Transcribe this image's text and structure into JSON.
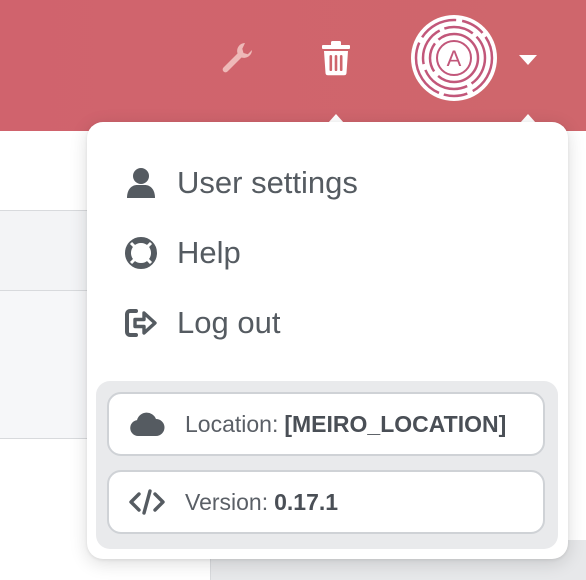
{
  "header": {
    "icons": [
      "wrench-icon",
      "trash-icon",
      "avatar",
      "caret-down-icon"
    ],
    "avatar_initial": "A",
    "accent": "#cf656c"
  },
  "menu": {
    "items": [
      {
        "label": "User settings",
        "icon": "user-icon"
      },
      {
        "label": "Help",
        "icon": "lifebuoy-icon"
      },
      {
        "label": "Log out",
        "icon": "logout-icon"
      }
    ]
  },
  "info": {
    "location_label": "Location:",
    "location_value": "[MEIRO_LOCATION]",
    "version_label": "Version:",
    "version_value": "0.17.1"
  }
}
